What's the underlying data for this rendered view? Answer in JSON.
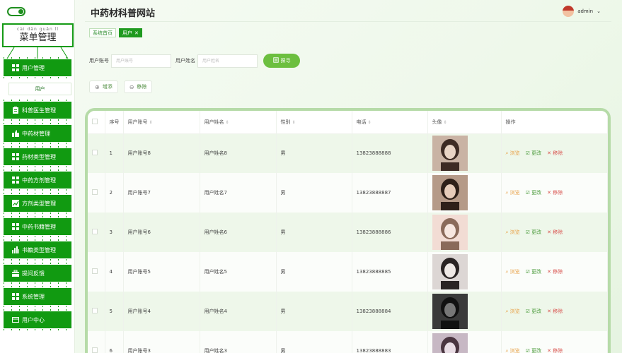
{
  "sidebar": {
    "menu_pinyin": "cài dān guǎn lǐ",
    "menu_title": "菜单管理",
    "items": [
      {
        "label": "用户管理",
        "icon": "grid-icon"
      },
      {
        "label": "用户",
        "sub": true
      },
      {
        "label": "科普医生管理",
        "icon": "clipboard-icon"
      },
      {
        "label": "中药材管理",
        "icon": "thumb-icon"
      },
      {
        "label": "药材类型管理",
        "icon": "grid-icon"
      },
      {
        "label": "中药方剂管理",
        "icon": "grid-icon"
      },
      {
        "label": "方剂类型管理",
        "icon": "chart-line-icon"
      },
      {
        "label": "中药书籍管理",
        "icon": "grid-icon"
      },
      {
        "label": "书籍类型管理",
        "icon": "bar-chart-icon"
      },
      {
        "label": "提问反馈",
        "icon": "briefcase-icon"
      },
      {
        "label": "系统管理",
        "icon": "grid-icon"
      },
      {
        "label": "用户中心",
        "icon": "card-icon"
      }
    ]
  },
  "header": {
    "title": "中药材科普网站",
    "user": "admin",
    "user_caret": "⌄"
  },
  "tabs": [
    {
      "label": "系统首页",
      "active": false
    },
    {
      "label": "用户",
      "active": true,
      "close": "✕"
    }
  ],
  "search": {
    "account_label": "用户账号",
    "account_placeholder": "用户账号",
    "name_label": "用户姓名",
    "name_placeholder": "用户姓名",
    "button": "探寻"
  },
  "actions": {
    "add": "增添",
    "remove": "移除"
  },
  "table": {
    "columns": [
      "序号",
      "用户账号",
      "用户姓名",
      "性别",
      "电话",
      "头像",
      "操作"
    ],
    "rows": [
      {
        "no": "1",
        "account": "用户账号8",
        "name": "用户姓名8",
        "gender": "男",
        "phone": "13823888888"
      },
      {
        "no": "2",
        "account": "用户账号7",
        "name": "用户姓名7",
        "gender": "男",
        "phone": "13823888887"
      },
      {
        "no": "3",
        "account": "用户账号6",
        "name": "用户姓名6",
        "gender": "男",
        "phone": "13823888886"
      },
      {
        "no": "4",
        "account": "用户账号5",
        "name": "用户姓名5",
        "gender": "男",
        "phone": "13823888885"
      },
      {
        "no": "5",
        "account": "用户账号4",
        "name": "用户姓名4",
        "gender": "男",
        "phone": "13823888884"
      },
      {
        "no": "6",
        "account": "用户账号3",
        "name": "用户姓名3",
        "gender": "男",
        "phone": "13823888883"
      }
    ],
    "ops": {
      "view": "浏览",
      "edit": "更改",
      "delete": "移除"
    }
  },
  "colors": {
    "primary": "#119a11",
    "accent": "#6cbf3f",
    "view": "#e8a045",
    "delete": "#d9534f"
  }
}
